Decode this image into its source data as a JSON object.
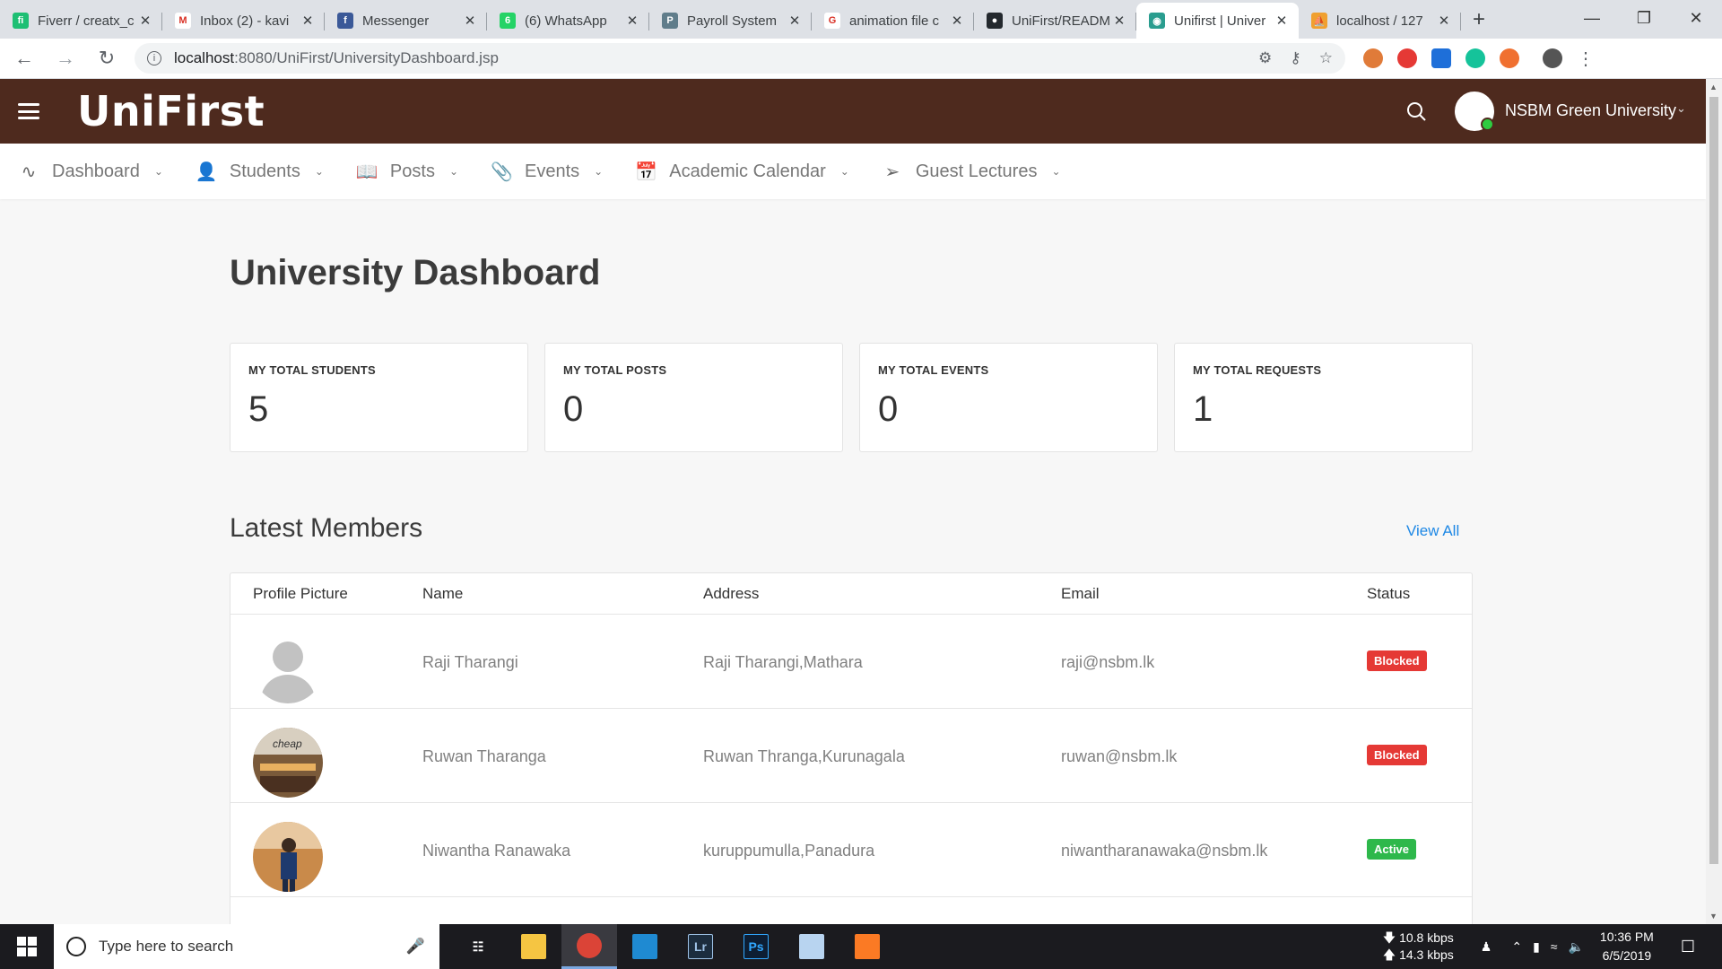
{
  "browser": {
    "tabs": [
      {
        "title": "Fiverr / creatx_c",
        "fav_color": "#1dbf73",
        "fav_text": "fi"
      },
      {
        "title": "Inbox (2) - kavi",
        "fav_color": "#ffffff",
        "fav_text": "M"
      },
      {
        "title": "Messenger",
        "fav_color": "#3b5998",
        "fav_text": "f"
      },
      {
        "title": "(6) WhatsApp",
        "fav_color": "#25d366",
        "fav_text": "6"
      },
      {
        "title": "Payroll System",
        "fav_color": "#607d8b",
        "fav_text": "P"
      },
      {
        "title": "animation file c",
        "fav_color": "#ffffff",
        "fav_text": "G"
      },
      {
        "title": "UniFirst/READM",
        "fav_color": "#24292e",
        "fav_text": "●"
      },
      {
        "title": "Unifirst | Univer",
        "fav_color": "#2a9d8f",
        "fav_text": "◉",
        "active": true
      },
      {
        "title": "localhost / 127",
        "fav_color": "#f0a030",
        "fav_text": "⛵"
      }
    ],
    "new_tab": "+",
    "url_host": "localhost",
    "url_path": ":8080/UniFirst/UniversityDashboard.jsp"
  },
  "header": {
    "logo": "UniFirst",
    "user_name": "NSBM Green University"
  },
  "nav": [
    {
      "label": "Dashboard",
      "icon": "activity-icon",
      "glyph": "∿"
    },
    {
      "label": "Students",
      "icon": "user-plus-icon",
      "glyph": "👤"
    },
    {
      "label": "Posts",
      "icon": "book-open-icon",
      "glyph": "📖"
    },
    {
      "label": "Events",
      "icon": "paperclip-icon",
      "glyph": "📎"
    },
    {
      "label": "Academic Calendar",
      "icon": "calendar-icon",
      "glyph": "📅"
    },
    {
      "label": "Guest Lectures",
      "icon": "send-icon",
      "glyph": "➢"
    }
  ],
  "page": {
    "title": "University Dashboard",
    "cards": [
      {
        "label": "MY TOTAL STUDENTS",
        "value": "5"
      },
      {
        "label": "MY TOTAL POSTS",
        "value": "0"
      },
      {
        "label": "MY TOTAL EVENTS",
        "value": "0"
      },
      {
        "label": "MY TOTAL REQUESTS",
        "value": "1"
      }
    ],
    "section_title": "Latest Members",
    "view_all": "View All",
    "table": {
      "headers": [
        "Profile Picture",
        "Name",
        "Address",
        "Email",
        "Status"
      ],
      "rows": [
        {
          "name": "Raji Tharangi",
          "address": "Raji Tharangi,Mathara",
          "email": "raji@nsbm.lk",
          "status": "Blocked",
          "pic": "placeholder"
        },
        {
          "name": "Ruwan Tharanga",
          "address": "Ruwan Thranga,Kurunagala",
          "email": "ruwan@nsbm.lk",
          "status": "Blocked",
          "pic": "shop"
        },
        {
          "name": "Niwantha Ranawaka",
          "address": "kuruppumulla,Panadura",
          "email": "niwantharanawaka@nsbm.lk",
          "status": "Active",
          "pic": "person"
        }
      ]
    }
  },
  "taskbar": {
    "search_placeholder": "Type here to search",
    "net_down": "10.8 kbps",
    "net_up": "14.3 kbps",
    "time": "10:36 PM",
    "date": "6/5/2019"
  },
  "colors": {
    "header_bg": "#4e2a1e",
    "blocked": "#e53935",
    "active": "#2eb84b",
    "link": "#1e88e5"
  }
}
